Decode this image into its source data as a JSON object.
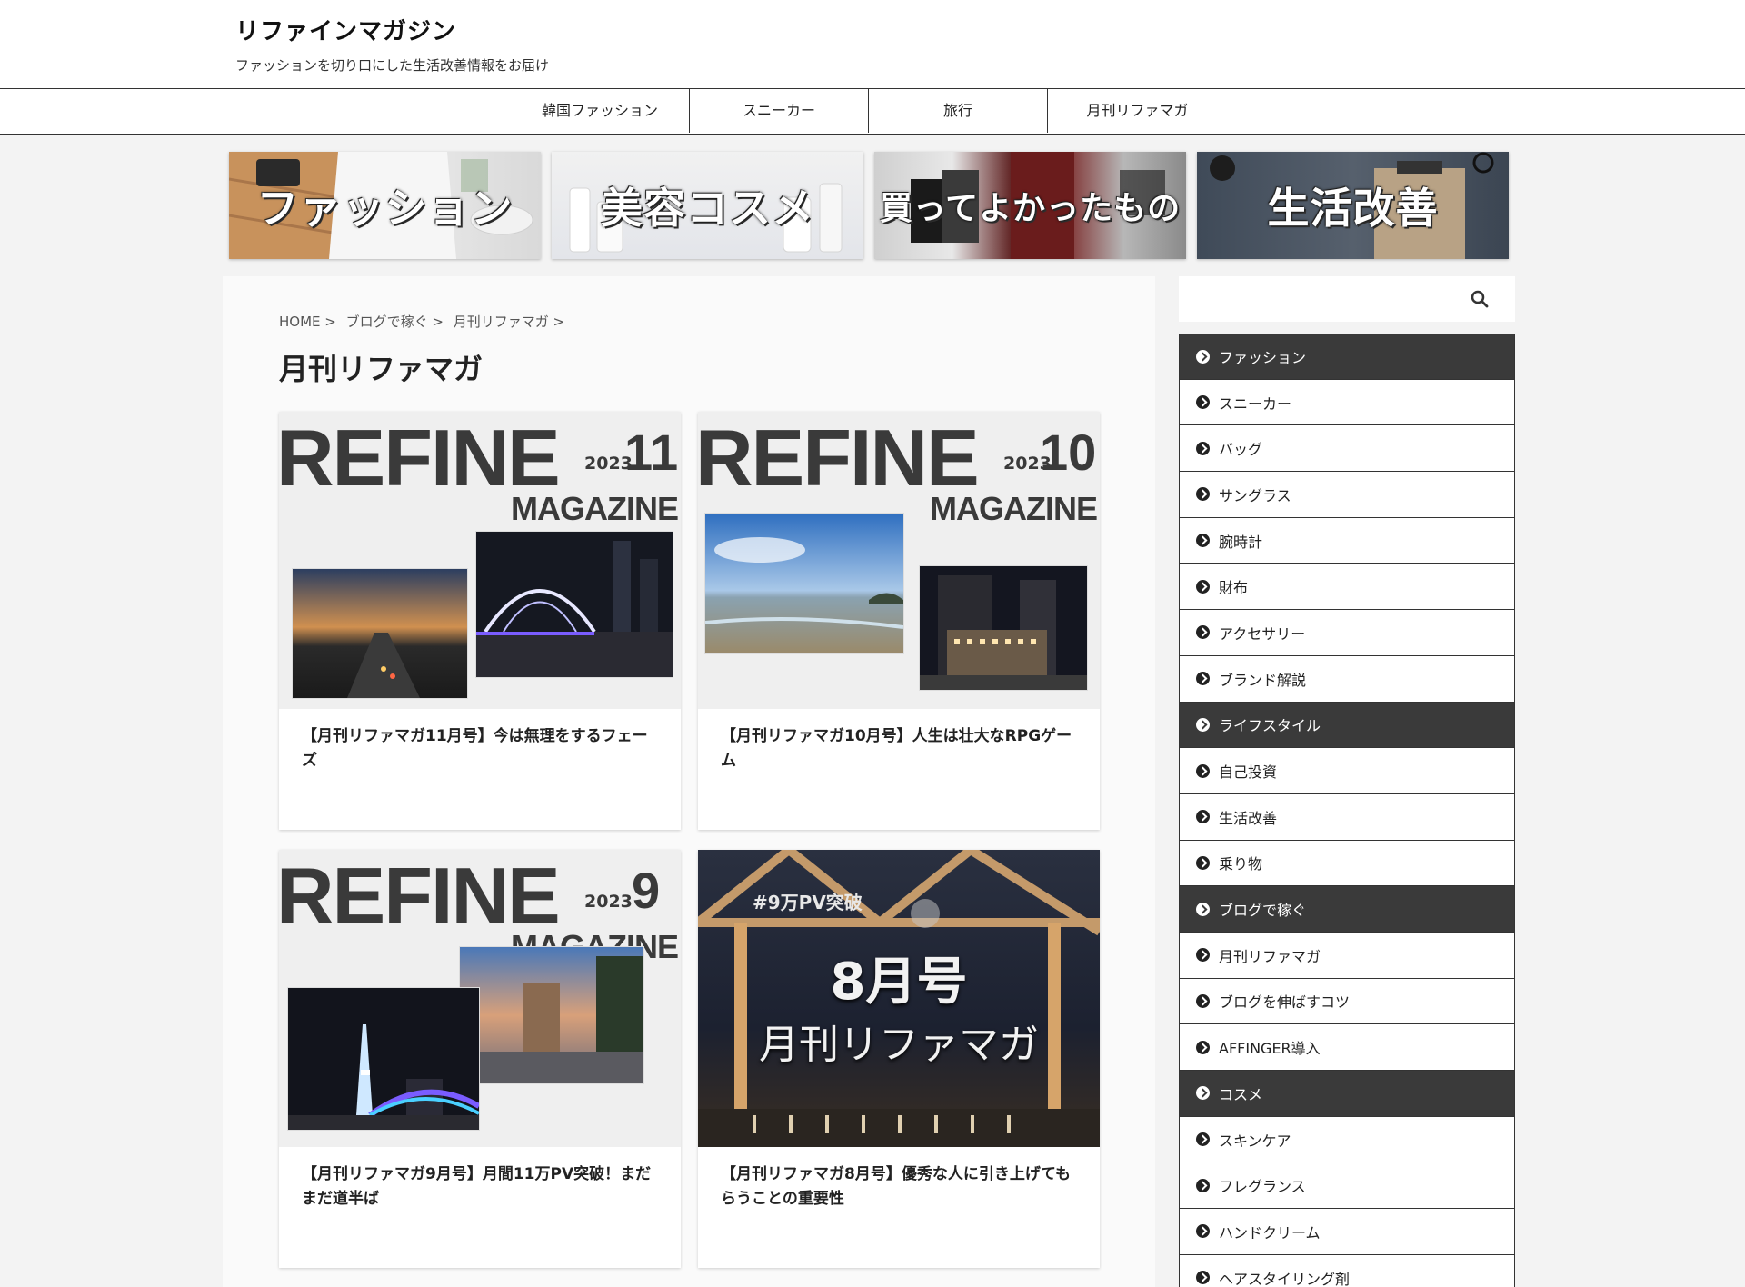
{
  "site": {
    "title": "リファインマガジン",
    "tagline": "ファッションを切り口にした生活改善情報をお届け"
  },
  "nav": [
    "韓国ファッション",
    "スニーカー",
    "旅行",
    "月刊リファマガ"
  ],
  "banners": [
    "ファッション",
    "美容コスメ",
    "買ってよかったもの",
    "生活改善"
  ],
  "breadcrumb": [
    "HOME >",
    "ブログで稼ぐ >",
    "月刊リファマガ >"
  ],
  "page_title": "月刊リファマガ",
  "posts": [
    {
      "title": "【月刊リファマガ11月号】今は無理をするフェーズ",
      "thumb": {
        "word": "REFINE",
        "year": "2023",
        "num": "11",
        "mag": "MAGAZINE"
      }
    },
    {
      "title": "【月刊リファマガ10月号】人生は壮大なRPGゲーム",
      "thumb": {
        "word": "REFINE",
        "year": "2023",
        "num": "10",
        "mag": "MAGAZINE"
      }
    },
    {
      "title": "【月刊リファマガ9月号】月間11万PV突破！まだまだ道半ば",
      "thumb": {
        "word": "REFINE",
        "year": "2023",
        "num": "9",
        "mag": "MAGAZINE"
      }
    },
    {
      "title": "【月刊リファマガ8月号】優秀な人に引き上げてもらうことの重要性",
      "thumb": {
        "badge": "#9万PV突破",
        "issue": "8月号",
        "name": "月刊リファマガ"
      }
    }
  ],
  "sidebar": {
    "search_placeholder": "",
    "items": [
      {
        "label": "ファッション",
        "parent": true
      },
      {
        "label": "スニーカー",
        "parent": false
      },
      {
        "label": "バッグ",
        "parent": false
      },
      {
        "label": "サングラス",
        "parent": false
      },
      {
        "label": "腕時計",
        "parent": false
      },
      {
        "label": "財布",
        "parent": false
      },
      {
        "label": "アクセサリー",
        "parent": false
      },
      {
        "label": "ブランド解説",
        "parent": false
      },
      {
        "label": "ライフスタイル",
        "parent": true
      },
      {
        "label": "自己投資",
        "parent": false
      },
      {
        "label": "生活改善",
        "parent": false
      },
      {
        "label": "乗り物",
        "parent": false
      },
      {
        "label": "ブログで稼ぐ",
        "parent": true
      },
      {
        "label": "月刊リファマガ",
        "parent": false
      },
      {
        "label": "ブログを伸ばすコツ",
        "parent": false
      },
      {
        "label": "AFFINGER導入",
        "parent": false
      },
      {
        "label": "コスメ",
        "parent": true
      },
      {
        "label": "スキンケア",
        "parent": false
      },
      {
        "label": "フレグランス",
        "parent": false
      },
      {
        "label": "ハンドクリーム",
        "parent": false
      },
      {
        "label": "ヘアスタイリング剤",
        "parent": false
      }
    ]
  }
}
